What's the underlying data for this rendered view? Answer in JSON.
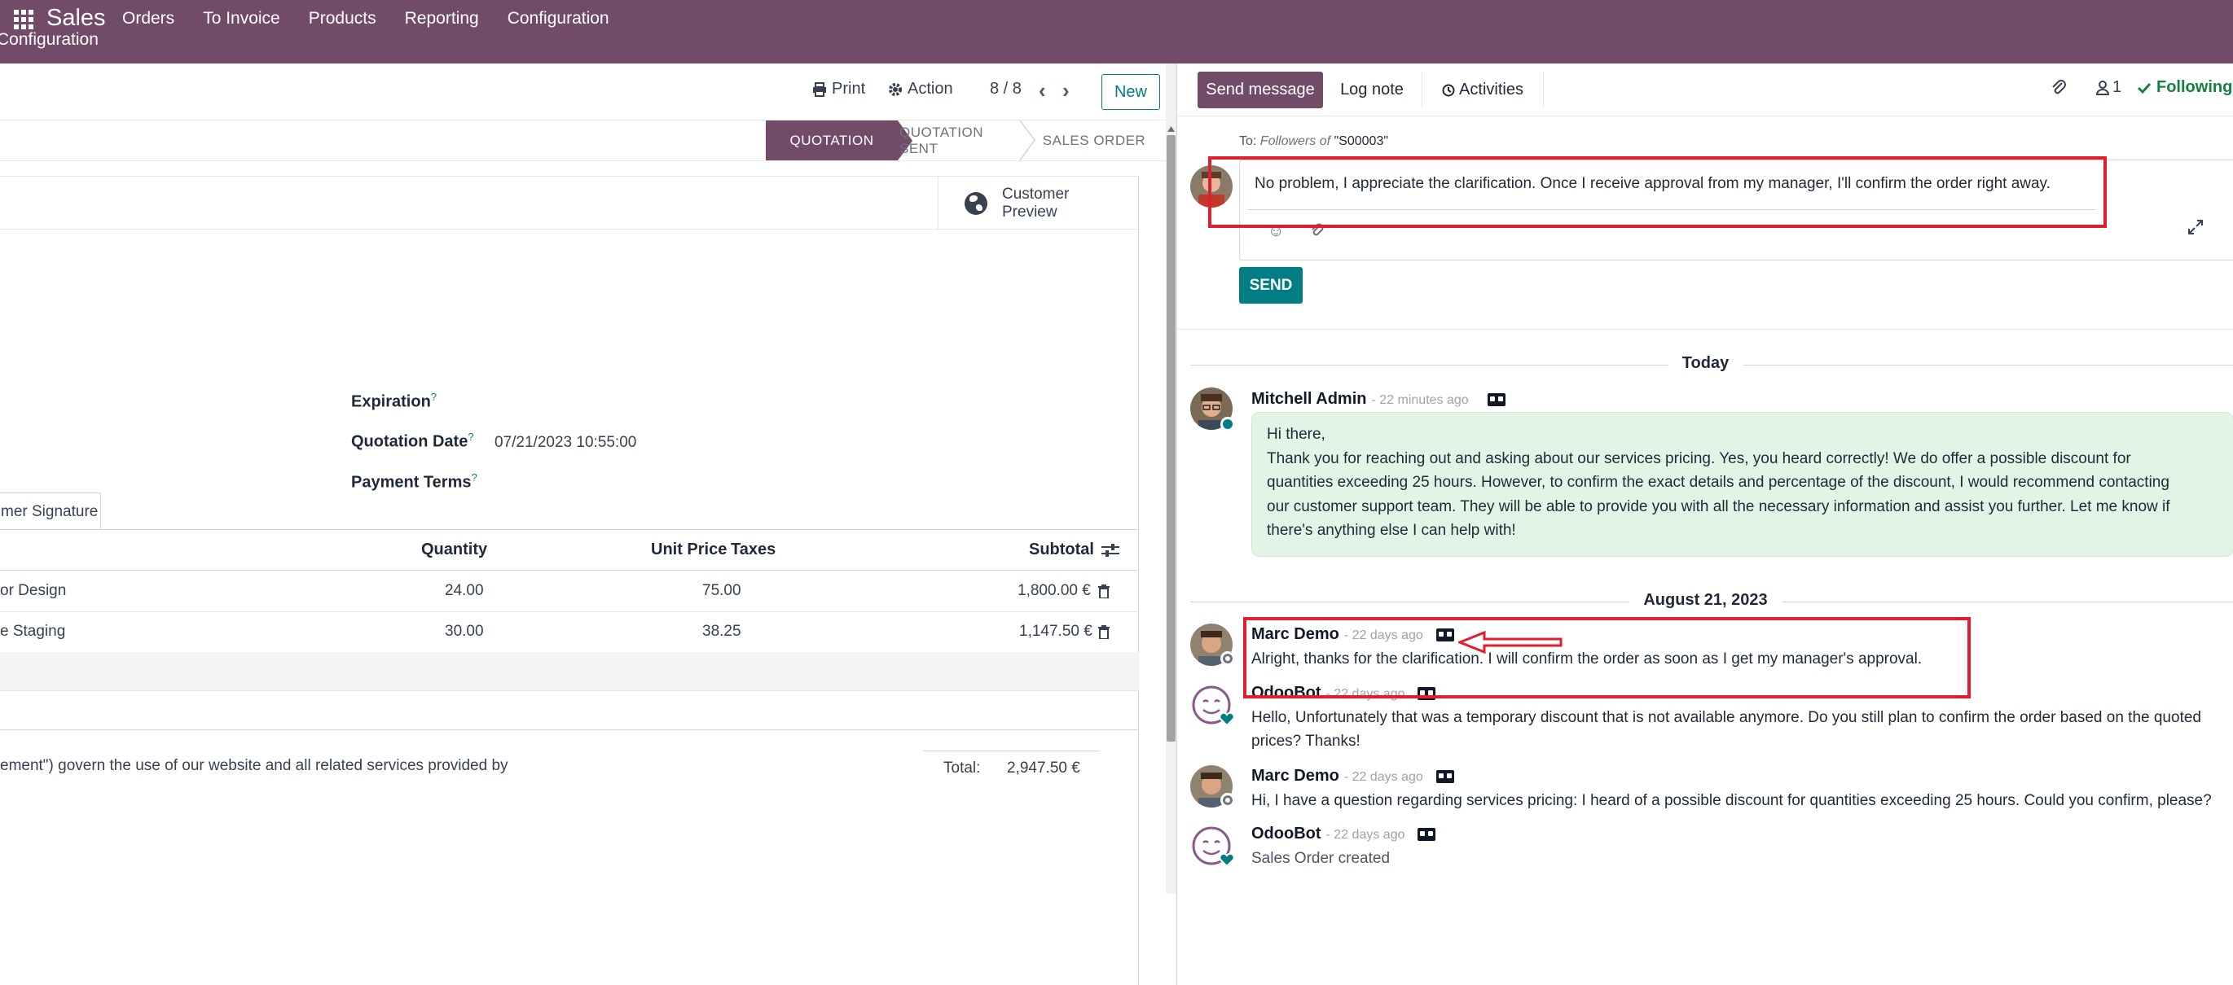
{
  "nav": {
    "app": "Sales",
    "menu": [
      "Orders",
      "To Invoice",
      "Products",
      "Reporting",
      "Configuration"
    ],
    "sub": "Configuration"
  },
  "control": {
    "print": "Print",
    "action": "Action",
    "pager": "8 / 8",
    "new": "New"
  },
  "stages": [
    "QUOTATION",
    "QUOTATION SENT",
    "SALES ORDER"
  ],
  "customer_preview": "Customer Preview",
  "fields": {
    "expiration_label": "Expiration",
    "quotation_date_label": "Quotation Date",
    "quotation_date_value": "07/21/2023 10:55:00",
    "payment_terms_label": "Payment Terms",
    "help": "?"
  },
  "tab": "mer Signature",
  "table": {
    "headers": {
      "quantity": "Quantity",
      "unit_price": "Unit Price",
      "taxes": "Taxes",
      "subtotal": "Subtotal"
    },
    "rows": [
      {
        "product": "or Design",
        "quantity": "24.00",
        "unit_price": "75.00",
        "subtotal": "1,800.00 €"
      },
      {
        "product": "e Staging",
        "quantity": "30.00",
        "unit_price": "38.25",
        "subtotal": "1,147.50 €"
      }
    ]
  },
  "terms": "ement\") govern the use of our website and all related services provided by",
  "total": {
    "label": "Total:",
    "value": "2,947.50 €"
  },
  "chatter": {
    "send_message": "Send message",
    "log_note": "Log note",
    "activities": "Activities",
    "followers_count": "1",
    "following": "Following",
    "to_prefix": "To:",
    "to_followers": "Followers of",
    "to_record": "\"S00003\"",
    "composer_text": "No problem, I appreciate the clarification. Once I receive approval from my manager, I'll confirm the order right away.",
    "send": "SEND",
    "today": "Today",
    "aug": "August 21, 2023",
    "messages": [
      {
        "author": "Mitchell Admin",
        "time": "- 22 minutes ago",
        "lines": [
          "Hi there,",
          "Thank you for reaching out and asking about our services pricing. Yes, you heard correctly! We do offer a possible discount for",
          "quantities exceeding 25 hours. However, to confirm the exact details and percentage of the discount, I would recommend contacting",
          "our customer support team. They will be able to provide you with all the necessary information and assist you further. Let me know if",
          "there's anything else I can help with!"
        ]
      },
      {
        "author": "Marc Demo",
        "time": "- 22 days ago",
        "lines": [
          "Alright, thanks for the clarification. I will confirm the order as soon as I get my manager's approval."
        ]
      },
      {
        "author": "OdooBot",
        "time": "- 22 days ago",
        "lines": [
          "Hello, Unfortunately that was a temporary discount that is not available anymore. Do you still plan to confirm the order based on the quoted",
          "prices? Thanks!"
        ]
      },
      {
        "author": "Marc Demo",
        "time": "- 22 days ago",
        "lines": [
          "Hi, I have a question regarding services pricing: I heard of a possible discount for quantities exceeding 25 hours. Could you confirm, please?"
        ]
      },
      {
        "author": "OdooBot",
        "time": "- 22 days ago",
        "lines": [
          "Sales Order created"
        ]
      }
    ]
  },
  "colors": {
    "brand": "#714b67",
    "teal": "#017e84",
    "highlight": "#e11d2e",
    "bubble": "#e3f4e6"
  }
}
